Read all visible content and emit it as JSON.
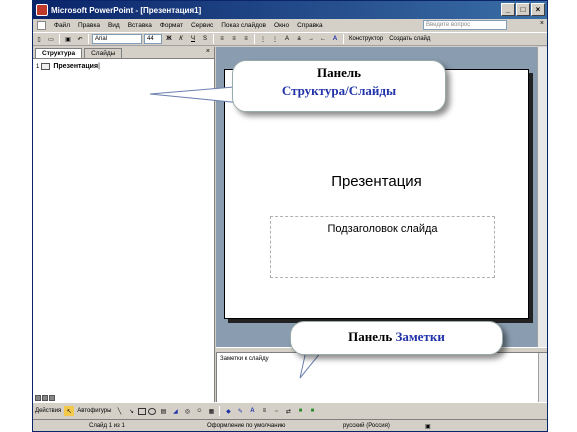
{
  "window": {
    "title": "Microsoft PowerPoint - [Презентация1]",
    "buttons": [
      "_",
      "□",
      "×"
    ]
  },
  "menu": {
    "items": [
      "Файл",
      "Правка",
      "Вид",
      "Вставка",
      "Формат",
      "Сервис",
      "Показ слайдов",
      "Окно",
      "Справка"
    ],
    "help_placeholder": "Введите вопрос",
    "close": "×"
  },
  "toolbar": {
    "font_name": "Arial",
    "font_size": "44",
    "bold": "Ж",
    "italic": "К",
    "underline": "Ч",
    "shadow": "S",
    "designer": "Конструктор",
    "new_slide": "Создать слайд"
  },
  "left_pane": {
    "tabs": [
      "Структура",
      "Слайды"
    ],
    "close": "×",
    "outline_number": "1",
    "outline_title": "Презентация"
  },
  "slide": {
    "title": "Презентация",
    "subtitle": "Подзаголовок слайда"
  },
  "notes": {
    "placeholder": "Заметки к слайду"
  },
  "drawing_toolbar": {
    "actions": "Действия",
    "autoshapes": "Автофигуры"
  },
  "status": {
    "slide": "Слайд 1 из 1",
    "design": "Оформление по умолчанию",
    "language": "русский (Россия)"
  },
  "callouts": {
    "outline_line1": "Панель",
    "outline_line2": "Структура/Слайды",
    "notes_prefix": "Панель",
    "notes_word": "Заметки"
  },
  "colors": {
    "title_bar": "#0a246a",
    "callout_accent": "#2233aa",
    "workspace": "#8a9db0"
  }
}
